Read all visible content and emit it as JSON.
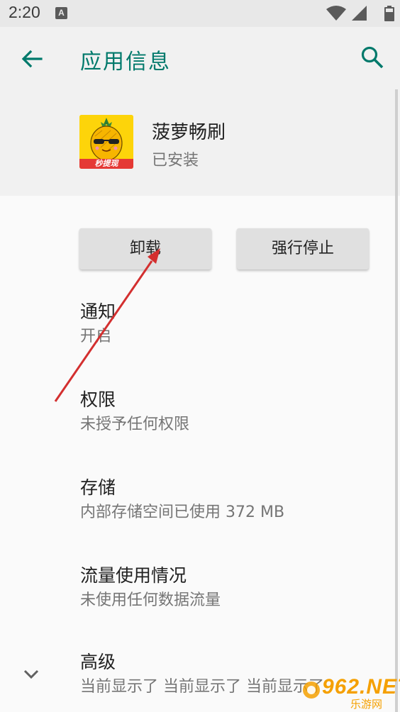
{
  "status_bar": {
    "time": "2:20",
    "notification_icon": "a-icon",
    "icons": [
      "wifi-icon",
      "signal-icon",
      "battery-icon"
    ]
  },
  "toolbar": {
    "title": "应用信息",
    "back_icon": "arrow-left-icon",
    "search_icon": "search-icon"
  },
  "app": {
    "name": "菠萝畅刷",
    "status": "已安装",
    "icon_badge": "秒提现"
  },
  "buttons": {
    "uninstall": "卸载",
    "force_stop": "强行停止"
  },
  "settings": [
    {
      "title": "通知",
      "summary": "开启"
    },
    {
      "title": "权限",
      "summary": "未授予任何权限"
    },
    {
      "title": "存储",
      "summary": "内部存储空间已使用 372 MB"
    },
    {
      "title": "流量使用情况",
      "summary": "未使用任何数据流量"
    },
    {
      "title": "高级",
      "summary": "当前显示了 当前显示了 当前显示了"
    }
  ],
  "watermark": {
    "text": "962.NET",
    "sub": "乐游网"
  },
  "colors": {
    "accent": "#00796b",
    "annotation": "#d32f2f",
    "app_icon_bg": "#fdd40a"
  }
}
